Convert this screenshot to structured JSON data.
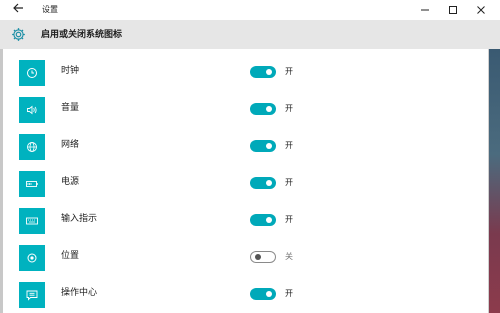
{
  "window": {
    "title": "设置"
  },
  "header": {
    "title": "启用或关闭系统图标"
  },
  "colors": {
    "accent": "#00b2bf",
    "toggle_on": "#00a9b9",
    "header_bg": "#e6e6e6"
  },
  "items": [
    {
      "label": "时钟",
      "icon": "clock-icon",
      "on": true,
      "state": "开"
    },
    {
      "label": "音量",
      "icon": "volume-icon",
      "on": true,
      "state": "开"
    },
    {
      "label": "网络",
      "icon": "network-icon",
      "on": true,
      "state": "开"
    },
    {
      "label": "电源",
      "icon": "battery-icon",
      "on": true,
      "state": "开"
    },
    {
      "label": "输入指示",
      "icon": "keyboard-icon",
      "on": true,
      "state": "开"
    },
    {
      "label": "位置",
      "icon": "location-icon",
      "on": false,
      "state": "关"
    },
    {
      "label": "操作中心",
      "icon": "action-center-icon",
      "on": true,
      "state": "开"
    }
  ]
}
